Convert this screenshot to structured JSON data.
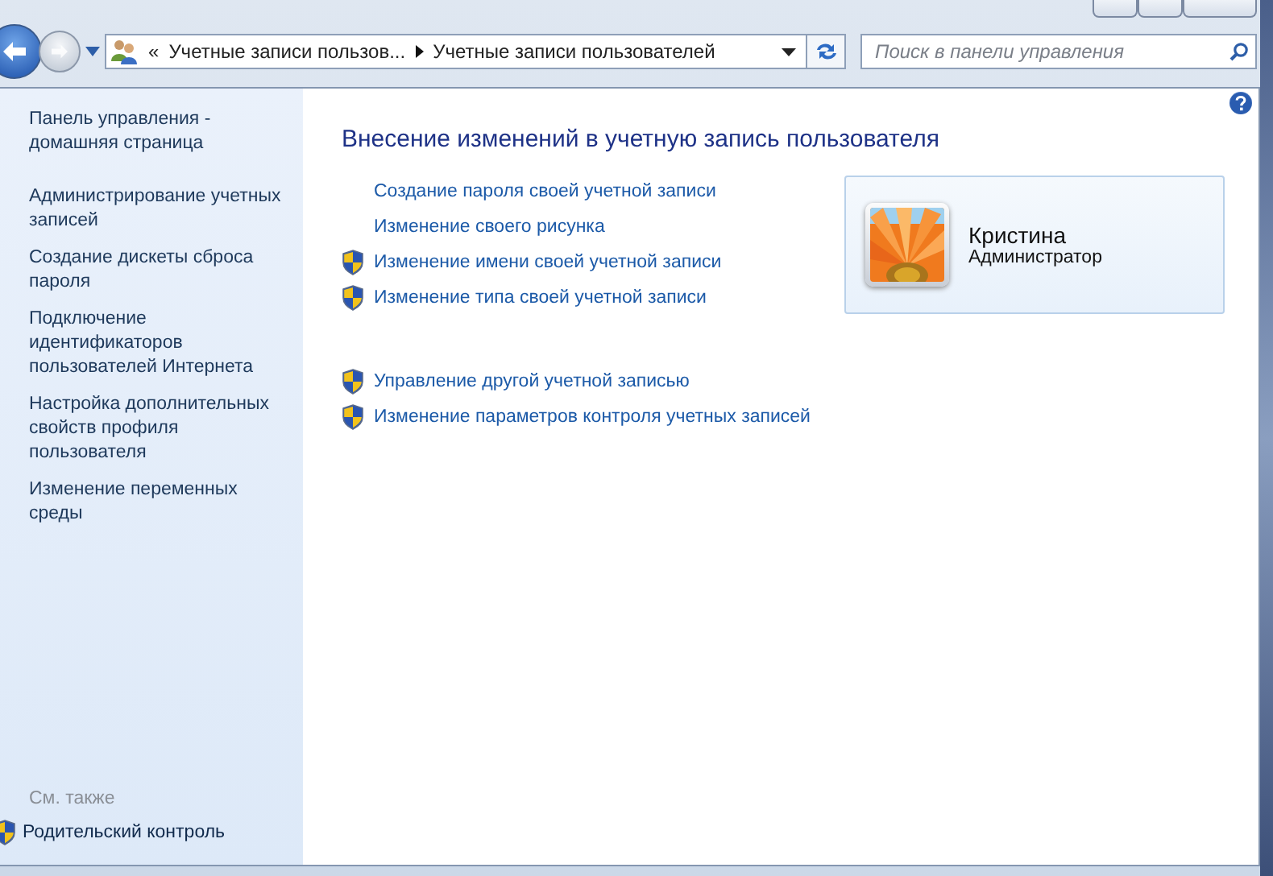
{
  "address_bar": {
    "crumbs": [
      "Учетные записи пользов...",
      "Учетные записи пользователей"
    ],
    "overflow": "«"
  },
  "search": {
    "placeholder": "Поиск в панели управления"
  },
  "sidebar": {
    "items": [
      {
        "label": "Панель управления - домашняя страница"
      },
      {
        "label": "Администрирование учетных записей"
      },
      {
        "label": "Создание дискеты сброса пароля"
      },
      {
        "label": "Подключение идентификаторов пользователей Интернета"
      },
      {
        "label": "Настройка дополнительных свойств профиля пользователя"
      },
      {
        "label": "Изменение переменных среды"
      }
    ],
    "see_also": {
      "heading": "См. также",
      "items": [
        {
          "label": "Родительский контроль",
          "shield": true
        }
      ]
    }
  },
  "main": {
    "title": "Внесение изменений в учетную запись пользователя",
    "task_groups": [
      [
        {
          "label": "Создание пароля своей учетной записи",
          "shield": false
        },
        {
          "label": "Изменение своего рисунка",
          "shield": false
        },
        {
          "label": "Изменение имени своей учетной записи",
          "shield": true
        },
        {
          "label": "Изменение типа своей учетной записи",
          "shield": true
        }
      ],
      [
        {
          "label": "Управление другой учетной записью",
          "shield": true
        },
        {
          "label": "Изменение параметров контроля учетных записей",
          "shield": true
        }
      ]
    ],
    "user": {
      "name": "Кристина",
      "role": "Администратор"
    }
  }
}
